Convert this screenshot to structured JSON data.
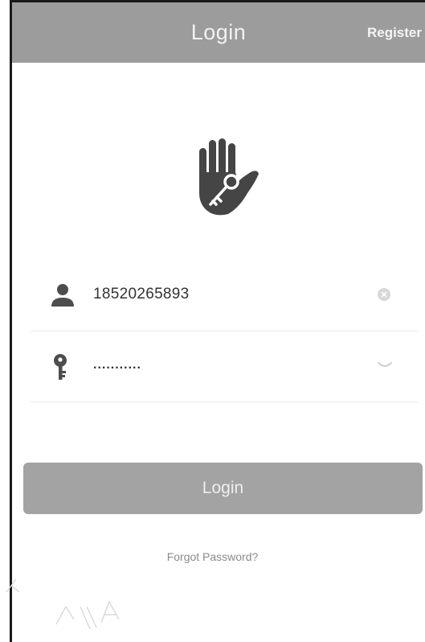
{
  "header": {
    "title": "Login",
    "register_label": "Register"
  },
  "logo": {
    "icon": "hand-key-icon"
  },
  "form": {
    "username": {
      "icon": "user-icon",
      "value": "18520265893",
      "action_icon": "clear-icon"
    },
    "password": {
      "icon": "key-icon",
      "value": "...........",
      "action_icon": "eye-closed-icon"
    }
  },
  "login_button": {
    "label": "Login"
  },
  "forgot_password": {
    "label": "Forgot Password?"
  },
  "colors": {
    "header_bg": "#9c9c9c",
    "button_bg": "#a3a3a3",
    "icon": "#4d4d4d"
  }
}
